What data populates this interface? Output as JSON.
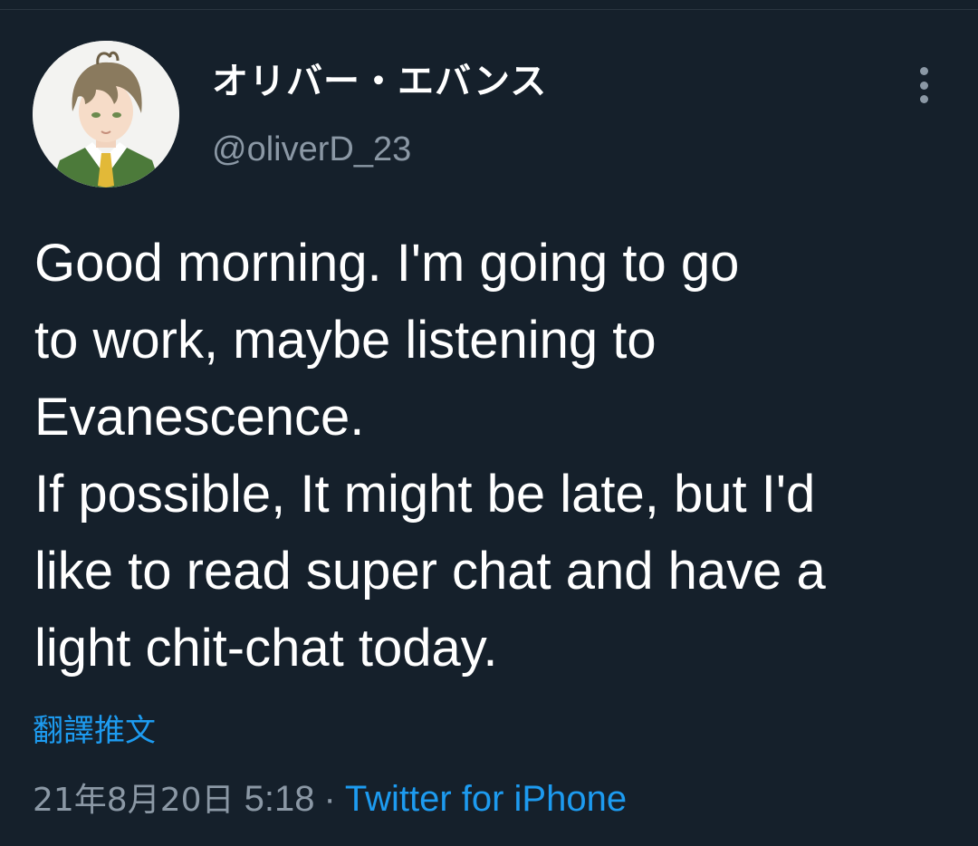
{
  "author": {
    "display_name": "オリバー・エバンス",
    "handle": "@oliverD_23",
    "avatar_icon": "avatar-illustration"
  },
  "more_icon": "more-options-icon",
  "tweet": {
    "lines": [
      "Good morning. I'm going to go",
      "to work, maybe listening to",
      "Evanescence.",
      "If possible, It might be late, but I'd",
      "like to read super chat and have a",
      "light chit-chat today."
    ]
  },
  "translate_label": "翻譯推文",
  "meta": {
    "date": "21年8月20日",
    "time": "5:18",
    "separator": "·",
    "source": "Twitter for iPhone"
  },
  "colors": {
    "background": "#15202b",
    "text": "#ffffff",
    "secondary": "#8b98a5",
    "link": "#1d9bf0"
  }
}
